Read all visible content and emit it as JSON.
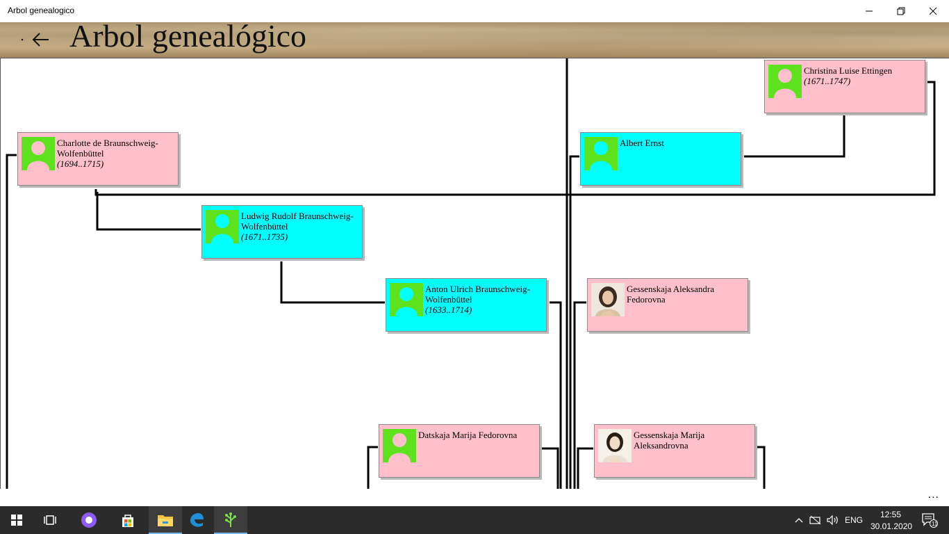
{
  "window": {
    "title": "Arbol genealogico",
    "minimize_icon": "minimize-icon",
    "maximize_icon": "restore-icon",
    "close_icon": "close-icon"
  },
  "header": {
    "back_icon": "back-arrow-icon",
    "title": "Arbol genealógico"
  },
  "colors": {
    "female": "#ffc0cb",
    "male": "#00ffff",
    "avatar_placeholder": "#5de21d",
    "avatar_silhouette": "#ffc0cb",
    "taskbar": "#2b2b2b"
  },
  "people": [
    {
      "id": "christina",
      "name": "Christina Luise Ettingen",
      "years": "(1671..1747)",
      "sex": "female",
      "photo": "placeholder"
    },
    {
      "id": "charlotte",
      "name": "Charlotte de Braunschweig-Wolfenbüttel",
      "years": "(1694..1715)",
      "sex": "female",
      "photo": "placeholder"
    },
    {
      "id": "albert",
      "name": "Albert Ernst",
      "years": "",
      "sex": "male",
      "photo": "placeholder"
    },
    {
      "id": "ludwig",
      "name": "Ludwig Rudolf Braunschweig-Wolfenbüttel",
      "years": "(1671..1735)",
      "sex": "male",
      "photo": "placeholder"
    },
    {
      "id": "anton",
      "name": "Anton Ulrich Braunschweig-Wolfenbüttel",
      "years": "(1633..1714)",
      "sex": "male",
      "photo": "placeholder"
    },
    {
      "id": "gess_aleksandra",
      "name": "Gessenskaja Aleksandra Fedorovna",
      "years": "",
      "sex": "female",
      "photo": "portrait"
    },
    {
      "id": "datskaja",
      "name": "Datskaja Marija Fedorovna",
      "years": "",
      "sex": "female",
      "photo": "placeholder"
    },
    {
      "id": "gess_marija",
      "name": "Gessenskaja Marija Aleksandrovna",
      "years": "",
      "sex": "female",
      "photo": "portrait"
    }
  ],
  "bottombar": {
    "more": "..."
  },
  "taskbar": {
    "items": [
      "windows-start-icon",
      "task-view-icon",
      "alice-assistant-icon",
      "microsoft-store-icon",
      "file-explorer-icon",
      "edge-browser-icon",
      "family-tree-app-icon"
    ],
    "tray": {
      "chevron_icon": "chevron-up-icon",
      "network_icon": "network-icon",
      "volume_icon": "volume-icon",
      "language": "ENG",
      "time": "12:55",
      "date": "30.01.2020",
      "notification_count": "11"
    }
  }
}
